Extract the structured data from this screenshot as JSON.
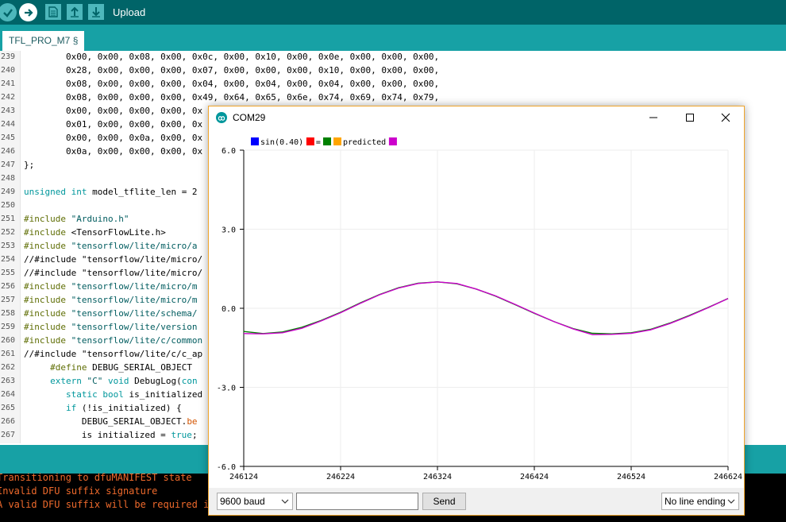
{
  "toolbar": {
    "upload_label": "Upload",
    "colors": {
      "bar": "#006468",
      "button": "#4db7bb"
    }
  },
  "tabs": [
    {
      "label": "TFL_PRO_M7 §"
    }
  ],
  "editor": {
    "lines": [
      {
        "num": "239",
        "segs": [
          {
            "t": "        0x00, 0x00, 0x08, 0x00, 0x0c, 0x00, 0x10, 0x00, 0x0e, 0x00, 0x00, 0x00,",
            "c": ""
          }
        ]
      },
      {
        "num": "240",
        "segs": [
          {
            "t": "        0x28, 0x00, 0x00, 0x00, 0x07, 0x00, 0x00, 0x00, 0x10, 0x00, 0x00, 0x00,",
            "c": ""
          }
        ]
      },
      {
        "num": "241",
        "segs": [
          {
            "t": "        0x08, 0x00, 0x00, 0x00, 0x04, 0x00, 0x04, 0x00, 0x04, 0x00, 0x00, 0x00,",
            "c": ""
          }
        ]
      },
      {
        "num": "242",
        "segs": [
          {
            "t": "        0x08, 0x00, 0x00, 0x00, 0x49, 0x64, 0x65, 0x6e, 0x74, 0x69, 0x74, 0x79,",
            "c": ""
          }
        ]
      },
      {
        "num": "243",
        "segs": [
          {
            "t": "        0x00, 0x00, 0x00, 0x00, 0x",
            "c": ""
          }
        ]
      },
      {
        "num": "244",
        "segs": [
          {
            "t": "        0x01, 0x00, 0x00, 0x00, 0x",
            "c": ""
          }
        ]
      },
      {
        "num": "245",
        "segs": [
          {
            "t": "        0x00, 0x00, 0x0a, 0x00, 0x",
            "c": ""
          }
        ]
      },
      {
        "num": "246",
        "segs": [
          {
            "t": "        0x0a, 0x00, 0x00, 0x00, 0x",
            "c": ""
          }
        ]
      },
      {
        "num": "247",
        "segs": [
          {
            "t": "};",
            "c": ""
          }
        ]
      },
      {
        "num": "248",
        "segs": []
      },
      {
        "num": "249",
        "segs": [
          {
            "t": "unsigned int",
            "c": "kw"
          },
          {
            "t": " model_tflite_len = 2",
            "c": ""
          }
        ]
      },
      {
        "num": "250",
        "segs": []
      },
      {
        "num": "251",
        "segs": [
          {
            "t": "#include",
            "c": "dir"
          },
          {
            "t": " \"Arduino.h\"",
            "c": "str"
          }
        ]
      },
      {
        "num": "252",
        "segs": [
          {
            "t": "#include",
            "c": "dir"
          },
          {
            "t": " <TensorFlowLite.h>",
            "c": ""
          }
        ]
      },
      {
        "num": "253",
        "segs": [
          {
            "t": "#include",
            "c": "dir"
          },
          {
            "t": " \"tensorflow/lite/micro/a",
            "c": "str"
          }
        ]
      },
      {
        "num": "254",
        "segs": [
          {
            "t": "//#include \"tensorflow/lite/micro/",
            "c": ""
          }
        ]
      },
      {
        "num": "255",
        "segs": [
          {
            "t": "//#include \"tensorflow/lite/micro/",
            "c": ""
          }
        ]
      },
      {
        "num": "256",
        "segs": [
          {
            "t": "#include",
            "c": "dir"
          },
          {
            "t": " \"tensorflow/lite/micro/m",
            "c": "str"
          }
        ]
      },
      {
        "num": "257",
        "segs": [
          {
            "t": "#include",
            "c": "dir"
          },
          {
            "t": " \"tensorflow/lite/micro/m",
            "c": "str"
          }
        ]
      },
      {
        "num": "258",
        "segs": [
          {
            "t": "#include",
            "c": "dir"
          },
          {
            "t": " \"tensorflow/lite/schema/",
            "c": "str"
          }
        ]
      },
      {
        "num": "259",
        "segs": [
          {
            "t": "#include",
            "c": "dir"
          },
          {
            "t": " \"tensorflow/lite/version",
            "c": "str"
          }
        ]
      },
      {
        "num": "260",
        "segs": [
          {
            "t": "#include",
            "c": "dir"
          },
          {
            "t": " \"tensorflow/lite/c/common",
            "c": "str"
          }
        ]
      },
      {
        "num": "261",
        "segs": [
          {
            "t": "//#include \"tensorflow/lite/c/c_ap",
            "c": ""
          }
        ]
      },
      {
        "num": "262",
        "segs": [
          {
            "t": "     #define",
            "c": "dir"
          },
          {
            "t": " DEBUG_SERIAL_OBJECT",
            "c": ""
          }
        ]
      },
      {
        "num": "263",
        "segs": [
          {
            "t": "     extern",
            "c": "kw"
          },
          {
            "t": " \"C\"",
            "c": "str"
          },
          {
            "t": " ",
            "c": ""
          },
          {
            "t": "void",
            "c": "kw"
          },
          {
            "t": " DebugLog(",
            "c": ""
          },
          {
            "t": "con",
            "c": "kw"
          }
        ]
      },
      {
        "num": "264",
        "segs": [
          {
            "t": "        static bool",
            "c": "kw"
          },
          {
            "t": " is_initialized",
            "c": ""
          }
        ]
      },
      {
        "num": "265",
        "segs": [
          {
            "t": "        if",
            "c": "kw"
          },
          {
            "t": " (!is_initialized) {",
            "c": ""
          }
        ]
      },
      {
        "num": "266",
        "segs": [
          {
            "t": "           DEBUG_SERIAL_OBJECT.",
            "c": ""
          },
          {
            "t": "be",
            "c": "fn"
          }
        ]
      },
      {
        "num": "267",
        "segs": [
          {
            "t": "           is initialized = ",
            "c": ""
          },
          {
            "t": "true",
            "c": "kw"
          },
          {
            "t": ";",
            "c": ""
          }
        ]
      }
    ]
  },
  "console": {
    "lines": [
      "Transitioning to dfuMANIFEST state",
      "Invalid DFU suffix signature",
      "A valid DFU suffix will be required in"
    ],
    "color": "#ef6a2c"
  },
  "plotter": {
    "title": "COM29",
    "baud_selected": "9600 baud",
    "send_input_value": "",
    "send_label": "Send",
    "line_ending_selected": "No line ending"
  },
  "chart_data": {
    "type": "line",
    "ylim": [
      -6.0,
      6.0
    ],
    "xlim": [
      246124,
      246624
    ],
    "y_ticks": [
      "6.0",
      "3.0",
      "0.0",
      "-3.0",
      "-6.0"
    ],
    "y_tick_values": [
      6,
      3,
      0,
      -3,
      -6
    ],
    "x_ticks": [
      "246124",
      "246224",
      "246324",
      "246424",
      "246524",
      "246624"
    ],
    "x_tick_values": [
      246124,
      246224,
      246324,
      246424,
      246524,
      246624
    ],
    "grid": true,
    "legend_position": "top-left",
    "legend": [
      {
        "label": "sin(0.40)",
        "color": "#0000ff"
      },
      {
        "label": "=",
        "color": "#ff0000"
      },
      {
        "label": "",
        "color": "#008000"
      },
      {
        "label": "predicted",
        "color": "#ffa500"
      },
      {
        "label": "",
        "color": "#cc00cc"
      }
    ],
    "series": [
      {
        "color": "#008000",
        "x": [
          246124,
          246144,
          246164,
          246184,
          246204,
          246224,
          246244,
          246264,
          246284,
          246304,
          246324,
          246344,
          246364,
          246384,
          246404,
          246424,
          246444,
          246464,
          246484,
          246504,
          246524,
          246544,
          246564,
          246584,
          246604,
          246624
        ],
        "y": [
          -0.88,
          -0.96,
          -0.9,
          -0.72,
          -0.46,
          -0.15,
          0.2,
          0.52,
          0.78,
          0.95,
          1.0,
          0.93,
          0.73,
          0.46,
          0.14,
          -0.19,
          -0.5,
          -0.77,
          -0.95,
          -0.97,
          -0.93,
          -0.8,
          -0.56,
          -0.27,
          0.04,
          0.37
        ]
      },
      {
        "color": "#cc00cc",
        "x": [
          246124,
          246144,
          246164,
          246184,
          246204,
          246224,
          246244,
          246264,
          246284,
          246304,
          246324,
          246344,
          246364,
          246384,
          246404,
          246424,
          246444,
          246464,
          246484,
          246504,
          246524,
          246544,
          246564,
          246584,
          246604,
          246624
        ],
        "y": [
          -0.96,
          -0.97,
          -0.93,
          -0.76,
          -0.48,
          -0.17,
          0.18,
          0.51,
          0.77,
          0.94,
          1.0,
          0.94,
          0.73,
          0.47,
          0.15,
          -0.18,
          -0.5,
          -0.78,
          -1.0,
          -0.99,
          -0.95,
          -0.82,
          -0.58,
          -0.29,
          0.03,
          0.37
        ]
      }
    ]
  }
}
